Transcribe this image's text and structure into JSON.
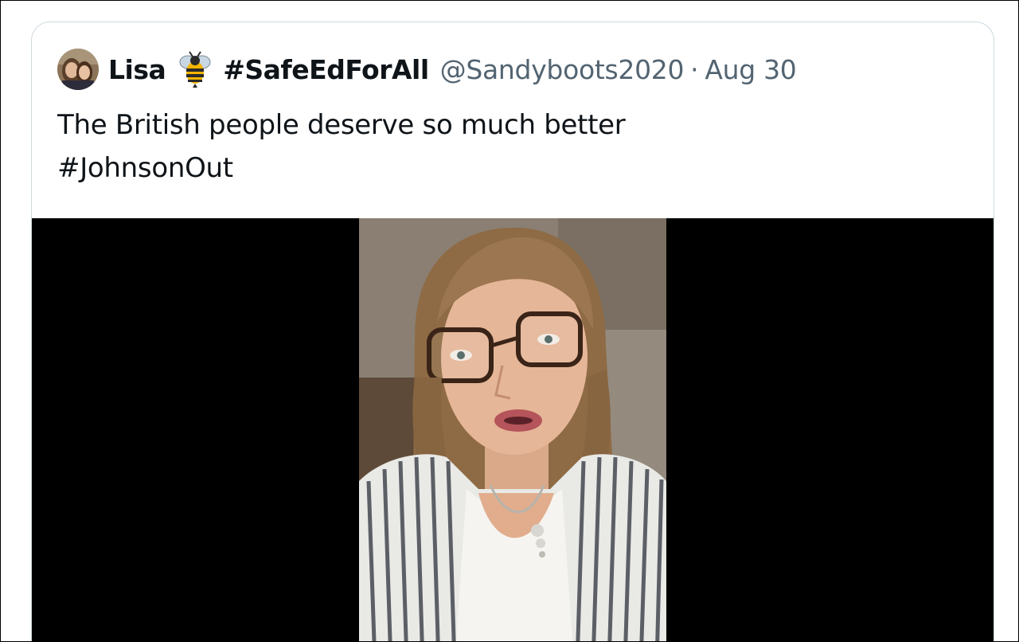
{
  "tweet": {
    "author": {
      "name": "Lisa",
      "emoji_icon": "bee-icon",
      "name_hashtag": "#SafeEdForAll",
      "handle": "@Sandyboots2020",
      "separator": "·",
      "date": "Aug 30"
    },
    "text_line1": "The British people deserve so much better",
    "text_line2": "#JohnsonOut",
    "media": {
      "type": "video",
      "subject": "woman-with-glasses-speaking"
    }
  },
  "colors": {
    "text_primary": "#0f1419",
    "text_secondary": "#536471",
    "card_border": "#cfd9de",
    "media_background": "#000000"
  }
}
